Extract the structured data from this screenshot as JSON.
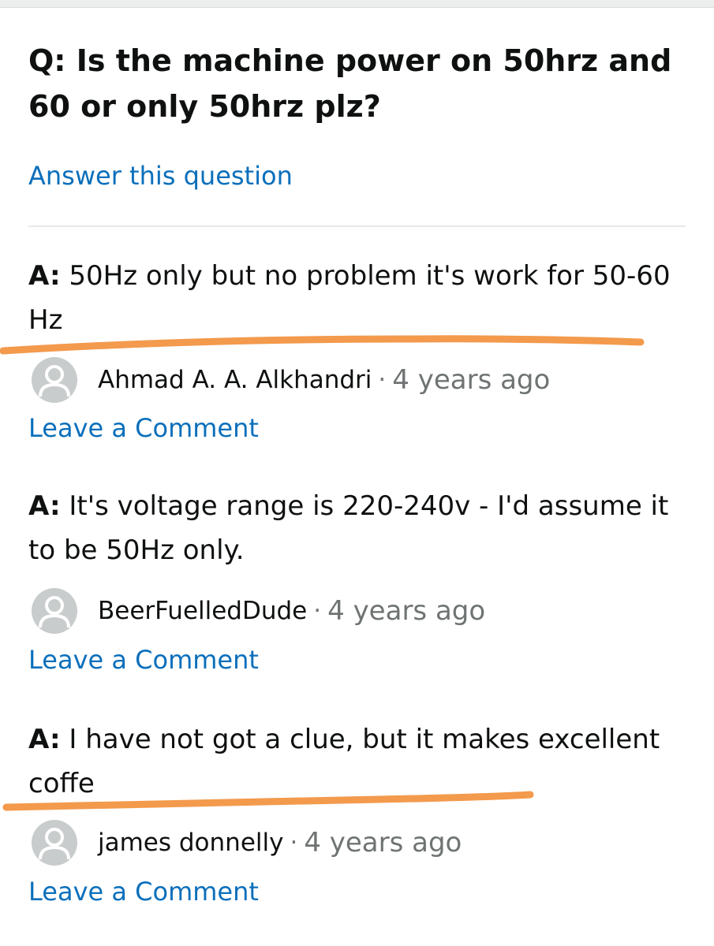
{
  "question": {
    "prefix": "Q:",
    "text": "Is the machine power on 50hrz and 60 or only 50hrz plz?",
    "answer_link": "Answer this question"
  },
  "answers": [
    {
      "prefix": "A:",
      "text": "50Hz only but no problem it's work for 50-60 Hz",
      "author": "Ahmad A. A. Alkhandri",
      "separator": "·",
      "age": "4 years ago",
      "comment_link": "Leave a Comment"
    },
    {
      "prefix": "A:",
      "text": "It's voltage range is 220-240v - I'd assume it to be 50Hz only.",
      "author": "BeerFuelledDude",
      "separator": "·",
      "age": "4 years ago",
      "comment_link": "Leave a Comment"
    },
    {
      "prefix": "A:",
      "text": "I have not got a clue, but it makes excellent coffe",
      "author": "james donnelly",
      "separator": "·",
      "age": "4 years ago",
      "comment_link": "Leave a Comment"
    }
  ],
  "colors": {
    "link": "#0b6fbb",
    "highlight_stroke": "#f39a4d",
    "avatar_bg": "#c9cccc",
    "meta_text": "#6f7373"
  },
  "icons": {
    "avatar": "default-user-avatar-icon"
  }
}
